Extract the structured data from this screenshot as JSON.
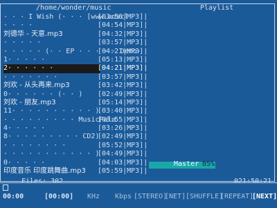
{
  "window": {
    "path": "/home/wonder/music",
    "playlist_title": "Playlist"
  },
  "rows": [
    {
      "name": "· · · I Wish (· · · [www.aoscl",
      "info": "[03:56|MP3]|",
      "cn": false
    },
    {
      "name": "· · · ·",
      "info": "[04:54|MP3]|",
      "cn": false
    },
    {
      "name": "刘德华 - 天意.mp3",
      "info": "[04:32|MP3]|",
      "cn": true
    },
    {
      "name": "· · · · ·",
      "info": "[03:57|MP3]|",
      "cn": false
    },
    {
      "name": "· · · · · (· · EP · · · · · Demo·",
      "info": "[04:21|MP3]|",
      "cn": false
    },
    {
      "name": "1· · · · ·",
      "info": "[05:13|MP3]|",
      "cn": false
    },
    {
      "name": "2· · · · · ·",
      "info": "[04:21|MP3]|",
      "cn": false,
      "selected": true
    },
    {
      "name": "· · · · · · ·",
      "info": "[03:57|MP3]|",
      "cn": false
    },
    {
      "name": "刘欢 - 从头再来.mp3",
      "info": "[03:42|MP3]|",
      "cn": true
    },
    {
      "name": "0· · · · · · (· · )",
      "info": "[02:49|MP3]|",
      "cn": false
    },
    {
      "name": "刘欢 - 朋友.mp3",
      "info": "[05:14|MP3]|",
      "cn": true
    },
    {
      "name": "11· · · · · · · · · · )",
      "info": "[03:40|MP3]|",
      "cn": false
    },
    {
      "name": "· · · · · · · · · MusicPala",
      "info": "[03:55|MP3]|",
      "cn": false
    },
    {
      "name": "4· · · · ·",
      "info": "[03:26|MP3]|",
      "cn": false
    },
    {
      "name": "8· · · · · · · · · CD2)",
      "info": "[02:49|MP3]|",
      "cn": false
    },
    {
      "name": "· · · · · · · ·",
      "info": "[05:52|MP3]|",
      "cn": false
    },
    {
      "name": "· · · · · · · · · · · )",
      "info": "[04:49|MP3]|",
      "cn": false
    },
    {
      "name": "0· · · · ·",
      "info": "[04:03|MP3]|",
      "cn": false
    },
    {
      "name": "印度音乐 印度跳舞曲.mp3",
      "info": "[05:59|MP3]|",
      "cn": true
    }
  ],
  "footer": {
    "files_label": "Files: 302",
    "master_label": "Master",
    "master_pct": "85%",
    "time": "021:50:21"
  },
  "status": {
    "elapsed": "00:00",
    "total": "[00:00]",
    "khz": "KHz",
    "kbps": "Kbps",
    "stereo": "[STEREO]",
    "net": "[NET]",
    "shuffle": "[SHUFFLE]",
    "repeat": "[REPEAT]",
    "next": "[NEXT]"
  },
  "colors": {
    "background": "#1b5a99",
    "selection": "#1a1a1a",
    "volume_bar": "#1aa7a7"
  }
}
